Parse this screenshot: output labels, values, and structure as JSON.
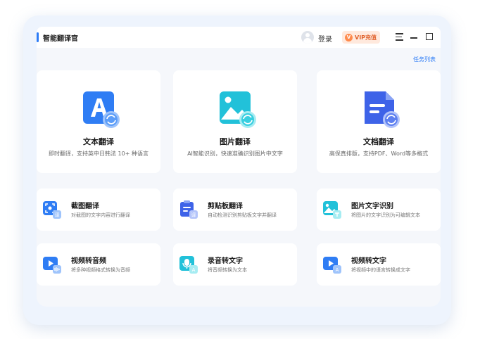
{
  "app": {
    "title": "智能翻译官"
  },
  "titlebar": {
    "login_label": "登录",
    "vip_label": "VIP充值",
    "vip_icon_char": "V"
  },
  "main": {
    "task_list_label": "任务列表",
    "feature_cards": [
      {
        "title": "文本翻译",
        "desc": "即时翻译，支持英中日韩法 10+ 种语言",
        "icon": "text-translate-icon"
      },
      {
        "title": "图片翻译",
        "desc": "AI智能识别，快速准确识别图片中文字",
        "icon": "image-translate-icon"
      },
      {
        "title": "文档翻译",
        "desc": "高保真排版，支持PDF、Word等多格式",
        "icon": "document-translate-icon"
      }
    ],
    "tool_cards": [
      {
        "title": "截图翻译",
        "desc": "对截图的文字内容进行翻译",
        "icon": "screenshot-translate-icon"
      },
      {
        "title": "剪贴板翻译",
        "desc": "自动检测识别剪贴板文字并翻译",
        "icon": "clipboard-translate-icon"
      },
      {
        "title": "图片文字识别",
        "desc": "将图片的文字识别为可编辑文本",
        "icon": "image-ocr-icon"
      },
      {
        "title": "视频转音频",
        "desc": "将多种视频格式转换为音频",
        "icon": "video-to-audio-icon"
      },
      {
        "title": "录音转文字",
        "desc": "将音频转换为文本",
        "icon": "audio-to-text-icon"
      },
      {
        "title": "视频转文字",
        "desc": "将视频中的语言转换成文字",
        "icon": "video-to-text-icon"
      }
    ]
  },
  "colors": {
    "accent": "#2d7cf6",
    "vip_bg": "#ffe9dd",
    "vip_text": "#e0612b"
  }
}
